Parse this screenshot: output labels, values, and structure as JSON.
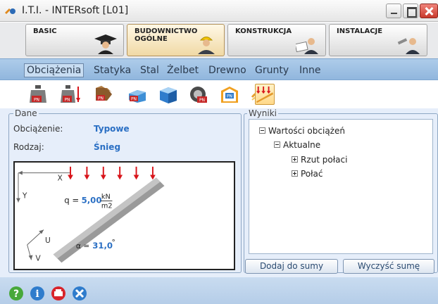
{
  "window": {
    "title": "I.T.I. - INTERsoft [L01]"
  },
  "modules": [
    {
      "label_line1": "BASIC",
      "label_line2": ""
    },
    {
      "label_line1": "BUDOWNICTWO",
      "label_line2": "OGÓLNE"
    },
    {
      "label_line1": "KONSTRUKCJA",
      "label_line2": ""
    },
    {
      "label_line1": "INSTALACJE",
      "label_line2": ""
    }
  ],
  "menu": [
    {
      "label": "Obciążenia",
      "active": true
    },
    {
      "label": "Statyka"
    },
    {
      "label": "Stal"
    },
    {
      "label": "Żelbet"
    },
    {
      "label": "Drewno"
    },
    {
      "label": "Grunty"
    },
    {
      "label": "Inne"
    }
  ],
  "toolbar": {
    "icons": [
      "weight-pn-icon",
      "weight-force-icon",
      "truck-load-icon",
      "block-load-icon",
      "wheel-load-icon",
      "crane-load-icon",
      "wind-load-icon",
      "snow-load-icon"
    ],
    "badge": "PN"
  },
  "dane": {
    "legend": "Dane",
    "fields": [
      {
        "label": "Obciążenie:",
        "value": "Typowe"
      },
      {
        "label": "Rodzaj:",
        "value": "Śnieg"
      }
    ]
  },
  "diagram": {
    "axis_x": "X",
    "axis_y": "Y",
    "axis_u": "U",
    "axis_v": "V",
    "q_prefix": "q = ",
    "q_value": "5,00",
    "q_unit_num": "kN",
    "q_unit_den": "m2",
    "alpha_prefix": "α = ",
    "alpha_value": "31,0",
    "alpha_unit": "°"
  },
  "wyniki": {
    "legend": "Wyniki",
    "tree": [
      {
        "label": "Wartości obciążeń",
        "expander": "minus"
      },
      {
        "label": "Aktualne",
        "expander": "minus"
      },
      {
        "label": "Rzut połaci",
        "expander": "plus"
      },
      {
        "label": "Połać",
        "expander": "plus"
      }
    ],
    "buttons": {
      "add": "Dodaj do sumy",
      "clear": "Wyczyść sumę"
    }
  },
  "status": {
    "icons": [
      "help-icon",
      "info-icon",
      "print-icon",
      "tools-icon"
    ]
  },
  "colors": {
    "accent": "#2a6fc4",
    "menubar": "#9fc0e4",
    "panel_bg": "#e6eefa",
    "load_arrow": "#d8141a",
    "close": "#c8392b"
  }
}
